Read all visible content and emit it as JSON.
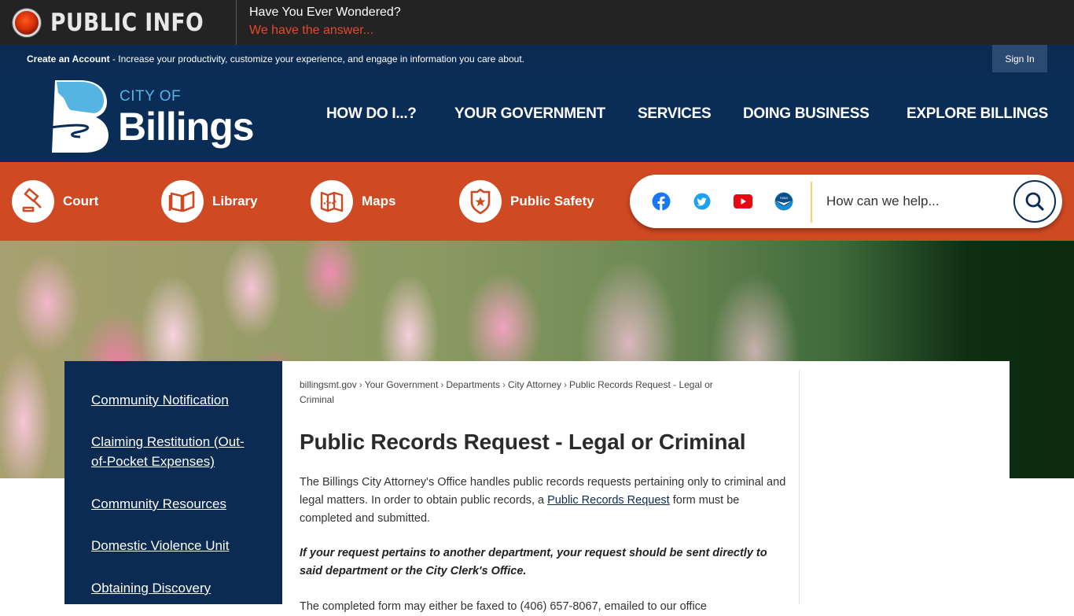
{
  "info_bar": {
    "title": "PUBLIC INFO",
    "question": "Have You Ever Wondered?",
    "answer": "We have the answer..."
  },
  "account_bar": {
    "link": "Create an Account",
    "message": " - Increase your productivity, customize your experience, and engage in information you care about.",
    "sign_in": "Sign In"
  },
  "brand": {
    "city_of": "CITY OF",
    "name": "Billings"
  },
  "nav": {
    "items": [
      {
        "label": "HOW DO I...?"
      },
      {
        "label": "YOUR GOVERNMENT"
      },
      {
        "label": "SERVICES"
      },
      {
        "label": "DOING BUSINESS"
      },
      {
        "label": "EXPLORE BILLINGS"
      }
    ]
  },
  "quick_links": [
    {
      "label": "Court",
      "icon": "gavel-icon"
    },
    {
      "label": "Library",
      "icon": "book-icon"
    },
    {
      "label": "Maps",
      "icon": "map-icon"
    },
    {
      "label": "Public Safety",
      "icon": "badge-icon"
    }
  ],
  "social": [
    {
      "name": "facebook-icon",
      "color": "#1877f2"
    },
    {
      "name": "twitter-icon",
      "color": "#1da1f2"
    },
    {
      "name": "youtube-icon",
      "color": "#e50914"
    },
    {
      "name": "noaa-icon",
      "color": "#1b8bcf"
    }
  ],
  "search": {
    "placeholder": "How can we help..."
  },
  "sidebar": {
    "links": [
      {
        "label": "Community Notification"
      },
      {
        "label": "Claiming Restitution (Out-of-Pocket Expenses)"
      },
      {
        "label": "Community Resources"
      },
      {
        "label": "Domestic Violence Unit"
      },
      {
        "label": "Obtaining Discovery"
      }
    ]
  },
  "breadcrumb": {
    "items": [
      "billingsmt.gov",
      "Your Government",
      "Departments",
      "City Attorney"
    ],
    "current": "Public Records Request - Legal or Criminal",
    "separator": "›"
  },
  "page": {
    "title": "Public Records Request - Legal or Criminal",
    "para1_before": "The Billings City Attorney's Office handles public records requests pertaining only to criminal and legal matters.  In order to obtain public records, a ",
    "para1_link": "Public Records Request",
    "para1_after": " form must be completed and submitted.",
    "para2": "If your request pertains to another department, your request should be sent directly to said department or the City Clerk's Office.",
    "para3": "The completed form may either be faxed to (406) 657-8067, emailed to our office"
  },
  "colors": {
    "navy": "#0b2b53",
    "orange": "#cf4922",
    "dark_bar": "#232323",
    "accent_red": "#e24a2c",
    "logo_blue": "#56b4e3"
  }
}
